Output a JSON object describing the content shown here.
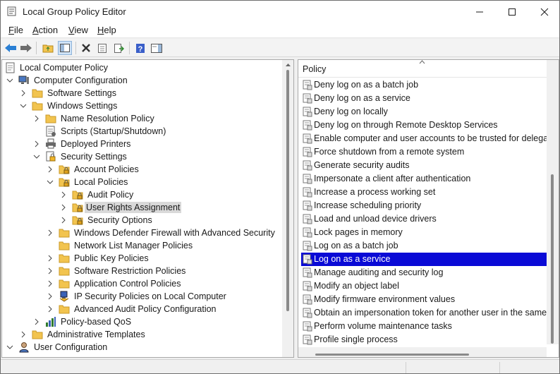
{
  "window": {
    "title": "Local Group Policy Editor"
  },
  "menu": [
    {
      "label": "File",
      "accel": "F",
      "rest": "ile"
    },
    {
      "label": "Action",
      "accel": "A",
      "rest": "ction"
    },
    {
      "label": "View",
      "accel": "V",
      "rest": "iew"
    },
    {
      "label": "Help",
      "accel": "H",
      "rest": "elp"
    }
  ],
  "toolbar": {
    "icons": [
      "back-arrow-icon",
      "forward-arrow-icon",
      "up-folder-icon",
      "show-hide-tree-icon",
      "delete-icon",
      "properties-icon",
      "export-list-icon",
      "help-icon",
      "show-hide-action-pane-icon"
    ]
  },
  "tree": {
    "root": "Local Computer Policy",
    "computer_configuration": "Computer Configuration",
    "software_settings": "Software Settings",
    "windows_settings": "Windows Settings",
    "name_resolution_policy": "Name Resolution Policy",
    "scripts": "Scripts (Startup/Shutdown)",
    "deployed_printers": "Deployed Printers",
    "security_settings": "Security Settings",
    "account_policies": "Account Policies",
    "local_policies": "Local Policies",
    "audit_policy": "Audit Policy",
    "user_rights_assignment": "User Rights Assignment",
    "security_options": "Security Options",
    "windows_defender_firewall": "Windows Defender Firewall with Advanced Security",
    "network_list_manager": "Network List Manager Policies",
    "public_key_policies": "Public Key Policies",
    "software_restriction_policies": "Software Restriction Policies",
    "application_control_policies": "Application Control Policies",
    "ip_security_policies": "IP Security Policies on Local Computer",
    "advanced_audit_policy": "Advanced Audit Policy Configuration",
    "policy_based_qos": "Policy-based QoS",
    "administrative_templates": "Administrative Templates",
    "user_configuration": "User Configuration"
  },
  "policy_pane": {
    "column_header": "Policy",
    "rows": [
      "Deny log on as a batch job",
      "Deny log on as a service",
      "Deny log on locally",
      "Deny log on through Remote Desktop Services",
      "Enable computer and user accounts to be trusted for delega...",
      "Force shutdown from a remote system",
      "Generate security audits",
      "Impersonate a client after authentication",
      "Increase a process working set",
      "Increase scheduling priority",
      "Load and unload device drivers",
      "Lock pages in memory",
      "Log on as a batch job",
      "Log on as a service",
      "Manage auditing and security log",
      "Modify an object label",
      "Modify firmware environment values",
      "Obtain an impersonation token for another user in the same...",
      "Perform volume maintenance tasks",
      "Profile single process"
    ],
    "selected": "Log on as a service"
  },
  "colors": {
    "selection": "#0a0ad6",
    "folder": "#f2c44f"
  }
}
